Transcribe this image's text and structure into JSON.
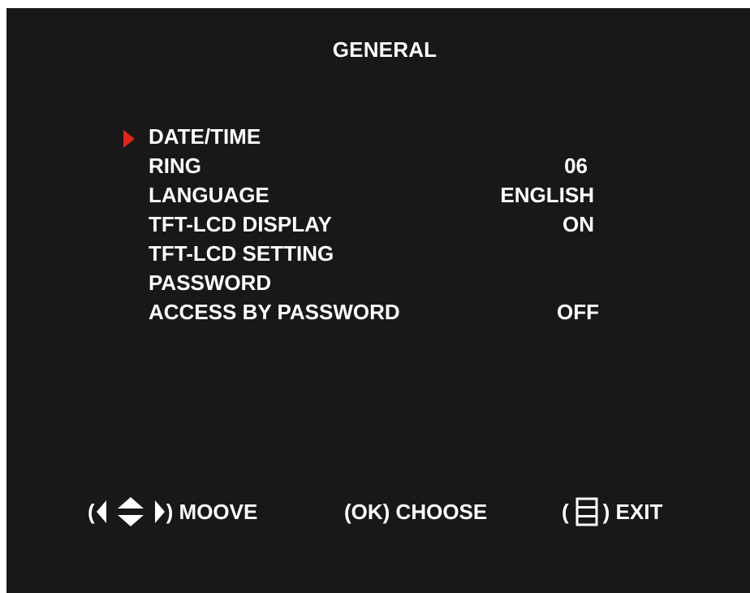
{
  "screen": {
    "title": "GENERAL"
  },
  "menu": {
    "selected_index": 0,
    "items": [
      {
        "label": "DATE/TIME",
        "value": ""
      },
      {
        "label": "RING",
        "value": "06"
      },
      {
        "label": "LANGUAGE",
        "value": "ENGLISH"
      },
      {
        "label": "TFT-LCD DISPLAY",
        "value": "ON"
      },
      {
        "label": "TFT-LCD SETTING",
        "value": ""
      },
      {
        "label": "PASSWORD",
        "value": ""
      },
      {
        "label": "ACCESS BY PASSWORD",
        "value": "OFF"
      }
    ]
  },
  "footer": {
    "move": {
      "open": "(",
      "close": ") MOOVE",
      "icon": "direction-arrows-icon"
    },
    "choose": {
      "text": "(OK) CHOOSE"
    },
    "exit": {
      "open": "(",
      "close": ") EXIT",
      "icon": "menu-icon"
    }
  },
  "colors": {
    "background": "#181818",
    "text": "#ffffff",
    "cursor": "#e2231a"
  }
}
